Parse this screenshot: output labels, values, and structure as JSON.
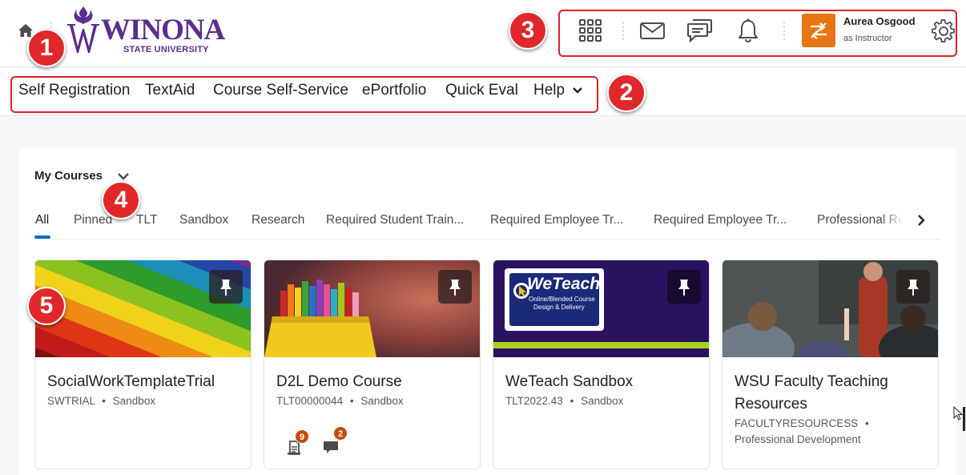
{
  "header": {
    "logo_name": "WINONA",
    "logo_subtitle": "STATE UNIVERSITY",
    "user": {
      "name": "Aurea Osgood",
      "role": "as Instructor"
    }
  },
  "navbar": {
    "items": [
      "Self Registration",
      "TextAid",
      "Course Self-Service",
      "ePortfolio",
      "Quick Eval",
      "Help"
    ]
  },
  "callouts": [
    "1",
    "2",
    "3",
    "4",
    "5"
  ],
  "widget": {
    "title": "My Courses",
    "tabs": [
      "All",
      "Pinned",
      "TLT",
      "Sandbox",
      "Research",
      "Required Student Train...",
      "Required Employee Tr...",
      "Required Employee Tr...",
      "Professional Re"
    ],
    "active_tab": "All"
  },
  "courses": [
    {
      "name": "SocialWorkTemplateTrial",
      "code": "SWTRIAL",
      "semester": "Sandbox"
    },
    {
      "name": "D2L Demo Course",
      "code": "TLT00000044",
      "semester": "Sandbox",
      "assignments_badge": "9",
      "discussions_badge": "2"
    },
    {
      "name": "WeTeach Sandbox",
      "code": "TLT2022.43",
      "semester": "Sandbox",
      "image_title": "WeTeach",
      "image_line1": "Online/Blended Course",
      "image_line2": "Design & Delivery"
    },
    {
      "name": "WSU Faculty Teaching Resources",
      "code": "FACULTYRESOURCESS",
      "semester": "Professional Development"
    }
  ],
  "colors": {
    "brand_purple": "#5b2d8e",
    "callout_red": "#e0282a",
    "user_tile": "#e87511",
    "active_tab": "#006fbf",
    "badge": "#c84a0c"
  }
}
